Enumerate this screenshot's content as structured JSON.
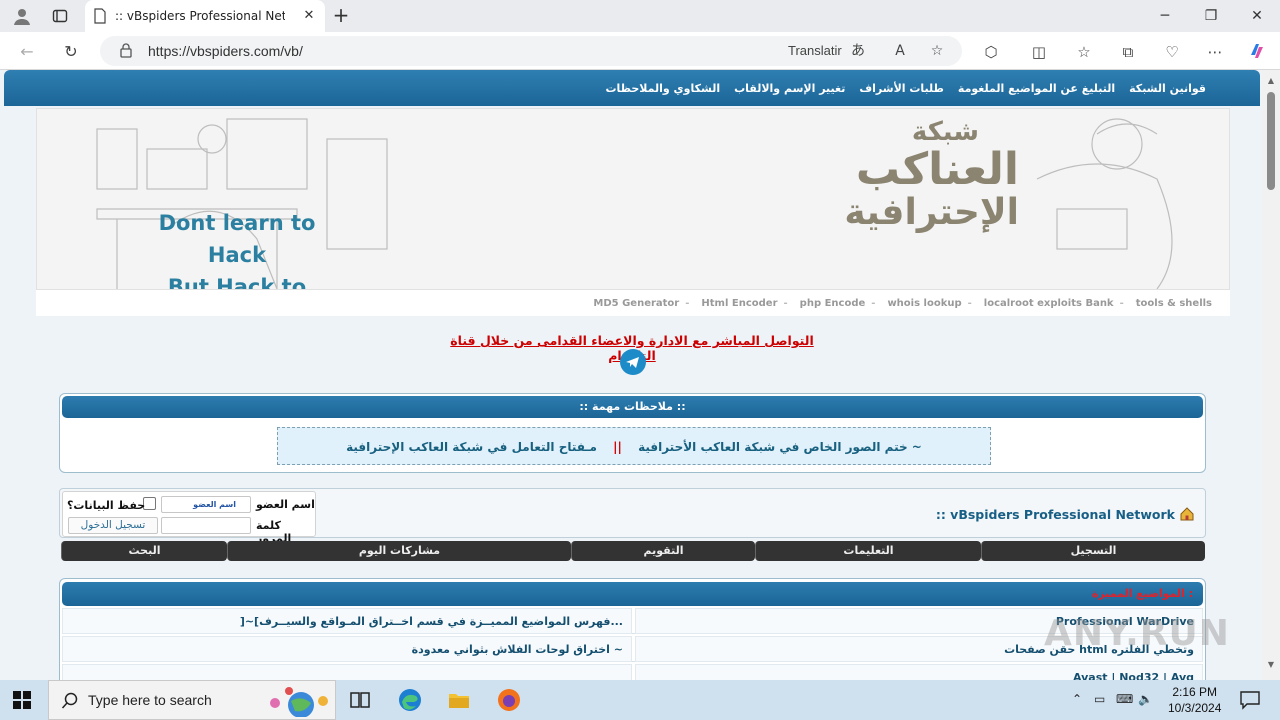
{
  "browser": {
    "tab_title": ":: vBspiders Professional Network",
    "url": "https://vbspiders.com/vb/",
    "translate_label": "Translatir"
  },
  "site": {
    "topnav": [
      "قوانين الشبكة",
      "التبليغ عن المواضيع الملغومة",
      "طلبات الأشراف",
      "تغيير الإسم والالقاب",
      "الشكاوي والملاحظات"
    ],
    "banner": {
      "logo_line1": "شبكة",
      "logo_line2": "العناكب",
      "logo_line3": "الإحترافية",
      "slogan1": "Dont learn to Hack",
      "slogan2": "But Hack to learn"
    },
    "subnav": [
      "tools & shells",
      "localroot exploits Bank",
      "whois lookup",
      "php Encode",
      "Html Encoder",
      "MD5 Generator"
    ],
    "telegram_text": "التواصل المباشر مع الادارة والاعضاء القدامى من خلال قناة التلغرام",
    "notes": {
      "header": ":: ملاحظات مهمة ::",
      "item1": "مـفتاح التعامل في شبكة العاكب الإحترافية ~",
      "separator": "||",
      "item2": "ختم الصور الخاص في شبكة العاكب الأحترافية"
    },
    "login": {
      "breadcrumb": ":: vBspiders Professional Network",
      "username_label": "اسم العضو",
      "username_value": "اسم العضو",
      "password_label": "كلمة المرور",
      "remember_label": "حفظ البيانات؟",
      "login_button": "تسجيل الدخول"
    },
    "menu": [
      "التسجيل",
      "التعليمات",
      "التقويم",
      "مشاركات اليوم",
      "البحث"
    ],
    "featured": {
      "title": "المواضيع المميزة :",
      "rows": [
        {
          "right": "Professional WarDrive",
          "left": "]~[فهرس المواضيع المميــزة في قسم اخــتراق المـواقع والسيــرف..."
        },
        {
          "right": "حقن صفحات html وتخطي الفلتره",
          "left": "اختراق لوحات الفلاش بثواني معدودة ~"
        },
        {
          "right": "Avast | Nod32 | Avg",
          "left": ""
        }
      ]
    },
    "watermark": "ANY.RUN"
  },
  "taskbar": {
    "search_placeholder": "Type here to search",
    "time": "2:16 PM",
    "date": "10/3/2024"
  }
}
